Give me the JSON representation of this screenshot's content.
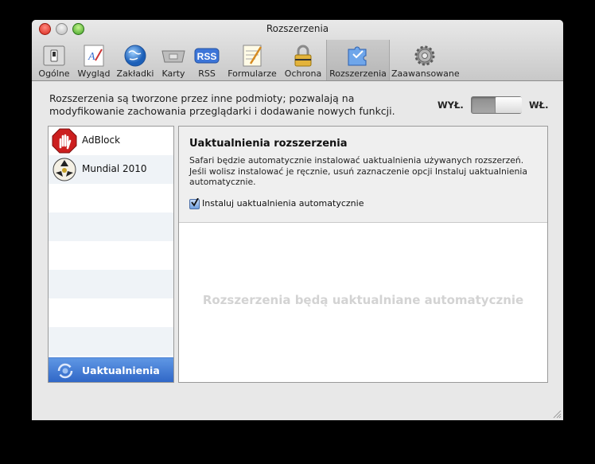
{
  "window": {
    "title": "Rozszerzenia"
  },
  "toolbar": {
    "items": [
      {
        "label": "Ogólne",
        "icon": "general-switch-icon"
      },
      {
        "label": "Wygląd",
        "icon": "appearance-icon"
      },
      {
        "label": "Zakładki",
        "icon": "bookmarks-globe-icon"
      },
      {
        "label": "Karty",
        "icon": "tabs-icon"
      },
      {
        "label": "RSS",
        "icon": "rss-icon"
      },
      {
        "label": "Formularze",
        "icon": "autofill-icon"
      },
      {
        "label": "Ochrona",
        "icon": "security-lock-icon"
      },
      {
        "label": "Rozszerzenia",
        "icon": "extensions-puzzle-icon",
        "selected": true
      },
      {
        "label": "Zaawansowane",
        "icon": "advanced-gear-icon"
      }
    ]
  },
  "description": "Rozszerzenia są tworzone przez inne podmioty; pozwalają na modyfikowanie zachowania przeglądarki i dodawanie nowych funkcji.",
  "toggle": {
    "off_label": "WYŁ.",
    "on_label": "WŁ.",
    "state": "on"
  },
  "extensions": [
    {
      "name": "AdBlock",
      "icon": "adblock-stop-hand-icon"
    },
    {
      "name": "Mundial 2010",
      "icon": "world-cup-ball-icon"
    }
  ],
  "updates": {
    "label": "Uaktualnienia",
    "icon": "refresh-updates-icon"
  },
  "detail": {
    "title": "Uaktualnienia rozszerzenia",
    "text": "Safari będzie automatycznie instalować uaktualnienia używanych rozszerzeń. Jeśli wolisz instalować je ręcznie, usuń zaznaczenie opcji Instaluj uaktualnienia automatycznie.",
    "checkbox_label": "Instaluj uaktualnienia automatycznie",
    "checkbox_checked": true,
    "placeholder": "Rozszerzenia będą uaktualniane automatycznie"
  },
  "colors": {
    "selection": "#2f66c6",
    "background": "#e8e8e8"
  }
}
